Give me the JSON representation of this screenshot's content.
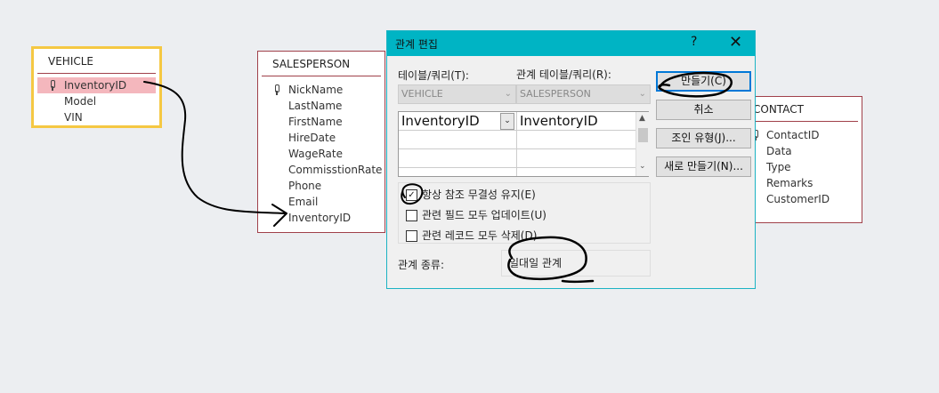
{
  "tables": {
    "vehicle": {
      "title": "VEHICLE",
      "fields": [
        "InventoryID",
        "Model",
        "VIN"
      ]
    },
    "salesperson": {
      "title": "SALESPERSON",
      "fields": [
        "NickName",
        "LastName",
        "FirstName",
        "HireDate",
        "WageRate",
        "CommisstionRate",
        "Phone",
        "Email",
        "InventoryID"
      ]
    },
    "contact": {
      "title": "CONTACT",
      "fields": [
        "ContactID",
        "Data",
        "Type",
        "Remarks",
        "CustomerID"
      ]
    }
  },
  "dialog": {
    "title": "관계 편집",
    "help": "?",
    "close": "✕",
    "table_label": "테이블/쿼리(T):",
    "related_label": "관계 테이블/쿼리(R):",
    "table_value": "VEHICLE",
    "related_value": "SALESPERSON",
    "grid": {
      "left": "InventoryID",
      "right": "InventoryID"
    },
    "options": {
      "enforce": "항상 참조 무결성 유지(E)",
      "cascade_update": "관련 필드 모두 업데이트(U)",
      "cascade_delete": "관련 레코드 모두 삭제(D)"
    },
    "relationship_type_label": "관계 종류:",
    "relationship_type_value": "일대일 관계",
    "buttons": {
      "create": "만들기(C)",
      "cancel": "취소",
      "join_type": "조인 유형(J)...",
      "create_new": "새로 만들기(N)..."
    }
  }
}
